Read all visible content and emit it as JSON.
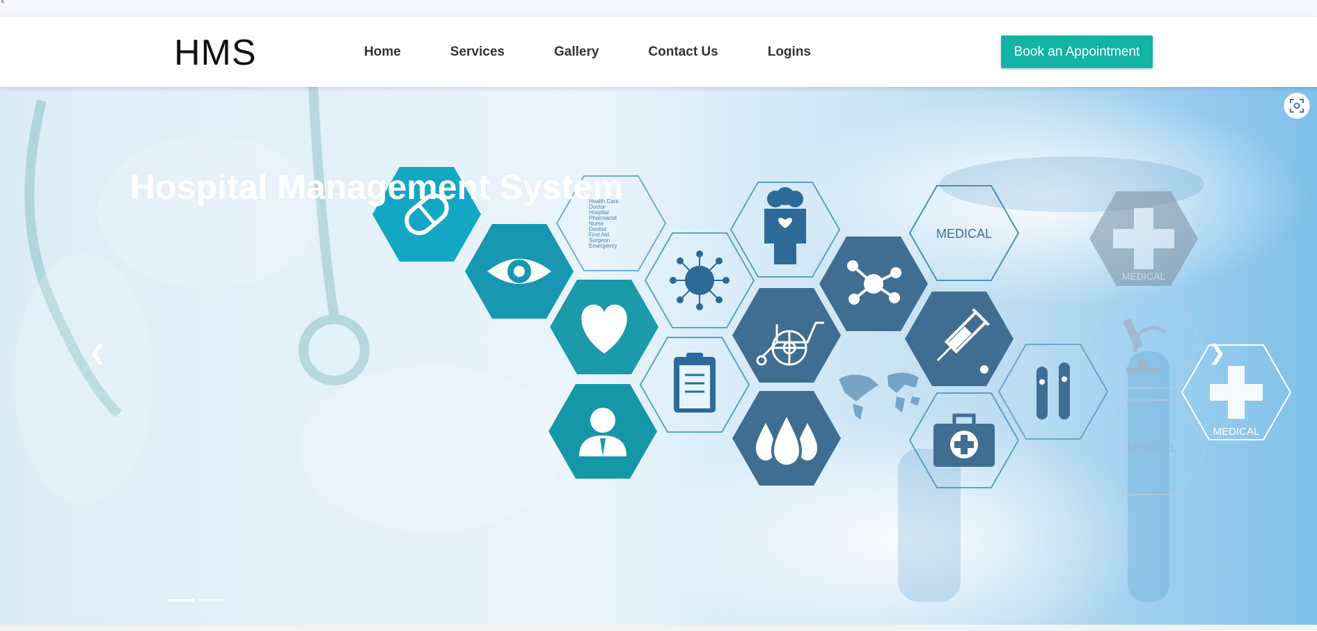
{
  "top_strip": {
    "caret": "‹"
  },
  "header": {
    "logo": "HMS",
    "nav": [
      "Home",
      "Services",
      "Gallery",
      "Contact Us",
      "Logins"
    ],
    "cta_label": "Book an Appointment"
  },
  "hero": {
    "title": "Hospital Management System",
    "prev_icon": "chevron-left-icon",
    "next_icon": "chevron-right-icon",
    "slides_count": 2,
    "active_slide": 1,
    "hex_labels": {
      "medical_1": "MEDICAL",
      "medical_2": "MEDICAL",
      "medical_3": "MEDICAL",
      "medical_4": "MEDICAL",
      "list_lines": [
        "Health Care",
        "Doctor",
        "Hospital",
        "Pharmacist",
        "Nurse",
        "Dentist",
        "First Aid",
        "Surgeon",
        "Emergency"
      ]
    }
  },
  "colors": {
    "accent": "#13b3a5",
    "overlay": "#5fc9c1",
    "hex_dark": "#3f6e92",
    "hex_teal": "#15a8b5"
  },
  "icons": [
    "capsule-icon",
    "eye-icon",
    "heart-icon",
    "user-icon",
    "virus-icon",
    "clipboard-icon",
    "doctor-icon",
    "wheelchair-icon",
    "drops-icon",
    "molecule-icon",
    "syringe-icon",
    "first-aid-kit-icon",
    "test-tubes-icon",
    "microscope-icon",
    "cross-icon",
    "world-map-icon",
    "screenshot-icon"
  ]
}
